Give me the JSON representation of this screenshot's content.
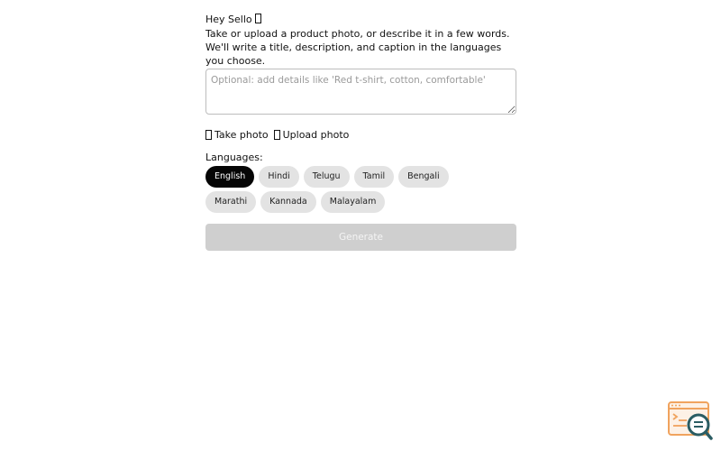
{
  "header": {
    "greeting": "Hey Sello",
    "intro": "Take or upload a product photo, or describe it in a few words. We'll write a title, description, and caption in the languages you choose."
  },
  "details_input": {
    "value": "",
    "placeholder": "Optional: add details like 'Red t-shirt, cotton, comfortable'"
  },
  "photo_actions": {
    "take_photo_label": "Take photo",
    "upload_photo_label": "Upload photo"
  },
  "languages": {
    "label": "Languages:",
    "options": [
      "English",
      "Hindi",
      "Telugu",
      "Tamil",
      "Bengali",
      "Marathi",
      "Kannada",
      "Malayalam"
    ],
    "selected": "English"
  },
  "generate": {
    "label": "Generate",
    "disabled": true
  },
  "colors": {
    "selected_chip": "#050505",
    "chip": "#e3e3e3",
    "disabled_button": "#cfcfcf",
    "logo_orange": "#f0a35e",
    "logo_teal": "#2b5d63"
  },
  "icons": {
    "corner": "inspector-window-magnifier-icon"
  }
}
